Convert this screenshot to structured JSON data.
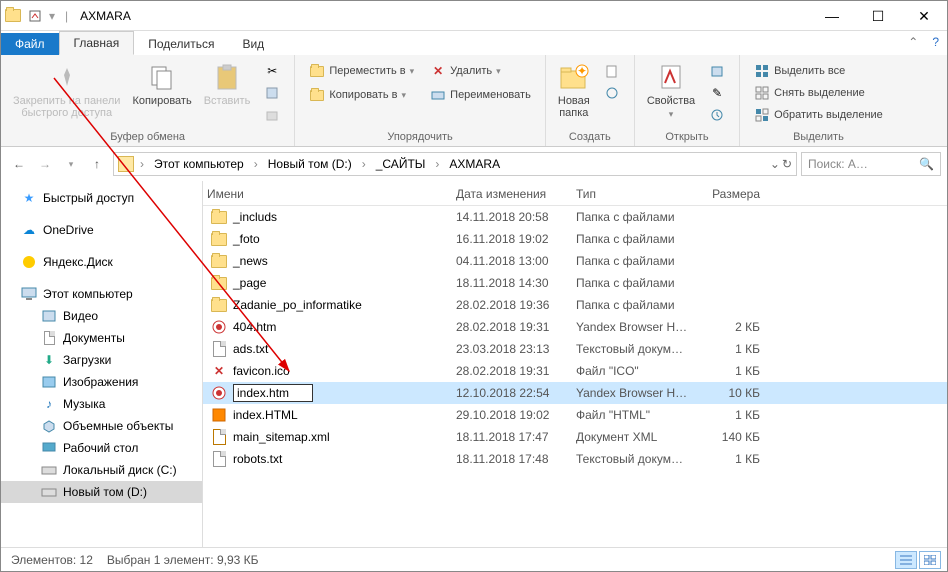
{
  "window": {
    "title": "AXMARA"
  },
  "tabs": {
    "file": "Файл",
    "home": "Главная",
    "share": "Поделиться",
    "view": "Вид"
  },
  "ribbon": {
    "pin": "Закрепить на панели\nбыстрого доступа",
    "copy": "Копировать",
    "paste": "Вставить",
    "group_clipboard": "Буфер обмена",
    "move_to": "Переместить в",
    "copy_to": "Копировать в",
    "delete": "Удалить",
    "rename": "Переименовать",
    "group_organize": "Упорядочить",
    "new_folder": "Новая\nпапка",
    "group_new": "Создать",
    "properties": "Свойства",
    "group_open": "Открыть",
    "select_all": "Выделить все",
    "select_none": "Снять выделение",
    "invert_sel": "Обратить выделение",
    "group_select": "Выделить"
  },
  "breadcrumb_items": [
    "Этот компьютер",
    "Новый том (D:)",
    "_САЙТЫ",
    "AXMARA"
  ],
  "search_placeholder": "Поиск: A…",
  "sidebar": {
    "quick": "Быстрый доступ",
    "onedrive": "OneDrive",
    "yandex": "Яндекс.Диск",
    "this_pc": "Этот компьютер",
    "videos": "Видео",
    "documents": "Документы",
    "downloads": "Загрузки",
    "pictures": "Изображения",
    "music": "Музыка",
    "objects3d": "Объемные объекты",
    "desktop": "Рабочий стол",
    "local_c": "Локальный диск (C:)",
    "new_vol_d": "Новый том (D:)"
  },
  "columns": {
    "name": "Имени",
    "date": "Дата изменения",
    "type": "Тип",
    "size": "Размера"
  },
  "files": [
    {
      "name": "_includs",
      "date": "14.11.2018 20:58",
      "type": "Папка с файлами",
      "size": "",
      "icon": "folder"
    },
    {
      "name": "_foto",
      "date": "16.11.2018 19:02",
      "type": "Папка с файлами",
      "size": "",
      "icon": "folder"
    },
    {
      "name": "_news",
      "date": "04.11.2018 13:00",
      "type": "Папка с файлами",
      "size": "",
      "icon": "folder"
    },
    {
      "name": "_page",
      "date": "18.11.2018 14:30",
      "type": "Папка с файлами",
      "size": "",
      "icon": "folder"
    },
    {
      "name": "Zadanie_po_informatike",
      "date": "28.02.2018 19:36",
      "type": "Папка с файлами",
      "size": "",
      "icon": "folder"
    },
    {
      "name": "404.htm",
      "date": "28.02.2018 19:31",
      "type": "Yandex Browser H…",
      "size": "2 КБ",
      "icon": "html"
    },
    {
      "name": "ads.txt",
      "date": "23.03.2018 23:13",
      "type": "Текстовый докум…",
      "size": "1 КБ",
      "icon": "txt"
    },
    {
      "name": "favicon.ico",
      "date": "28.02.2018 19:31",
      "type": "Файл \"ICO\"",
      "size": "1 КБ",
      "icon": "ico"
    },
    {
      "name": "index.htm",
      "date": "12.10.2018 22:54",
      "type": "Yandex Browser H…",
      "size": "10 КБ",
      "icon": "html",
      "selected": true,
      "renaming": true
    },
    {
      "name": "index.HTML",
      "date": "29.10.2018 19:02",
      "type": "Файл \"HTML\"",
      "size": "1 КБ",
      "icon": "htmlx"
    },
    {
      "name": "main_sitemap.xml",
      "date": "18.11.2018 17:47",
      "type": "Документ XML",
      "size": "140 КБ",
      "icon": "xml"
    },
    {
      "name": "robots.txt",
      "date": "18.11.2018 17:48",
      "type": "Текстовый докум…",
      "size": "1 КБ",
      "icon": "txt"
    }
  ],
  "status": {
    "count": "Элементов: 12",
    "selected": "Выбран 1 элемент: 9,93 КБ"
  }
}
